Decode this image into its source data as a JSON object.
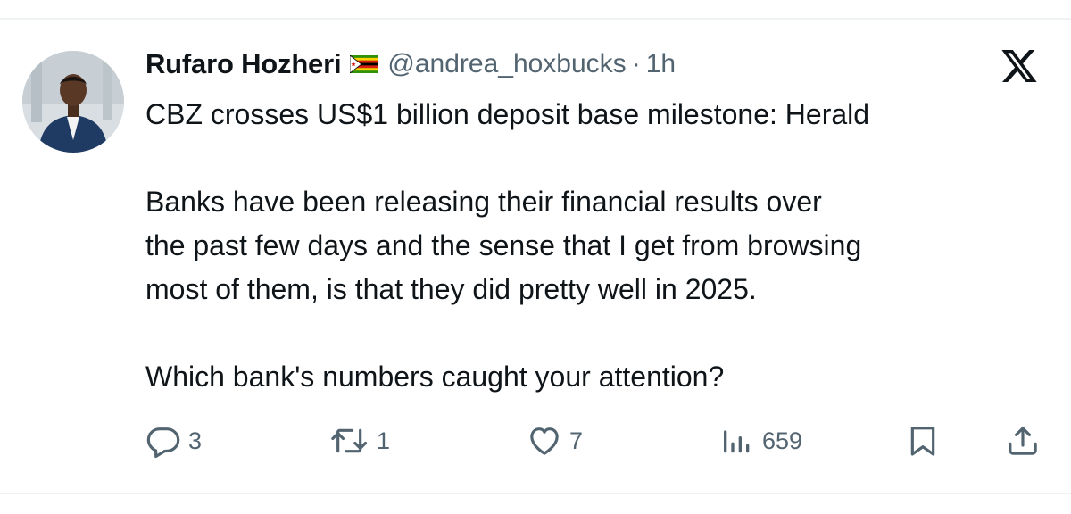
{
  "tweet": {
    "author": {
      "display_name": "Rufaro Hozheri",
      "flag_emoji": "zimbabwe-flag",
      "handle": "@andrea_hoxbucks",
      "separator": "·",
      "time": "1h"
    },
    "text_lines": [
      "CBZ crosses US$1 billion deposit base milestone: Herald",
      "",
      "Banks have been releasing their financial results over",
      "the past few days and the sense that I get from browsing",
      "most of them, is that they did pretty well in 2025.",
      "",
      "Which bank's numbers caught your attention?"
    ],
    "actions": {
      "reply": {
        "icon": "reply-icon",
        "count": "3"
      },
      "repost": {
        "icon": "repost-icon",
        "count": "1"
      },
      "like": {
        "icon": "heart-icon",
        "count": "7"
      },
      "views": {
        "icon": "views-icon",
        "count": "659"
      },
      "bookmark": {
        "icon": "bookmark-icon"
      },
      "share": {
        "icon": "share-icon"
      }
    }
  },
  "colors": {
    "text": "#0f1419",
    "secondary": "#536471",
    "divider": "#eff3f4"
  }
}
